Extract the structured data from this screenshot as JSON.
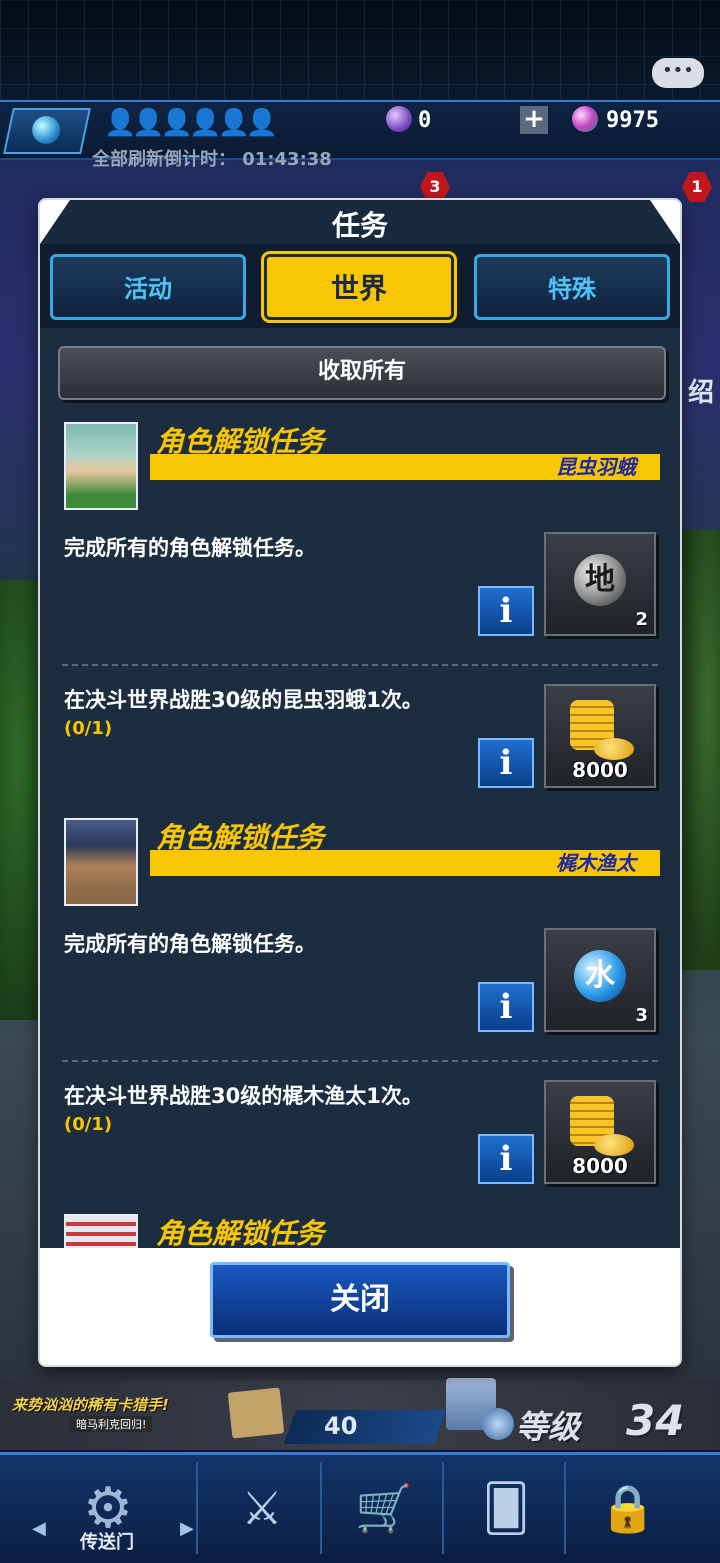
{
  "top": {
    "orb_count": "0",
    "gem_count": "9975",
    "refresh_label": "全部刷新倒计时：",
    "refresh_time": "01:43:38",
    "badge_left": "3",
    "badge_right": "1",
    "side_text": "绍"
  },
  "modal": {
    "title": "任务",
    "tabs": [
      {
        "label": "活动",
        "active": false
      },
      {
        "label": "世界",
        "active": true
      },
      {
        "label": "特殊",
        "active": false
      }
    ],
    "collect_all": "收取所有",
    "sections": [
      {
        "title": "角色解锁任务",
        "character": "昆虫羽蛾",
        "quests": [
          {
            "text": "完成所有的角色解锁任务。",
            "progress": "",
            "reward": {
              "type": "orb",
              "glyph": "地",
              "count": "2",
              "icon": "earth-orb-icon"
            }
          },
          {
            "text": "在决斗世界战胜30级的昆虫羽蛾1次。",
            "progress": "(0/1)",
            "reward": {
              "type": "coins",
              "count": "8000",
              "icon": "gold-coins-icon"
            }
          }
        ]
      },
      {
        "title": "角色解锁任务",
        "character": "梶木渔太",
        "quests": [
          {
            "text": "完成所有的角色解锁任务。",
            "progress": "",
            "reward": {
              "type": "orb",
              "glyph": "水",
              "count": "3",
              "icon": "water-orb-icon"
            }
          },
          {
            "text": "在决斗世界战胜30级的梶木渔太1次。",
            "progress": "(0/1)",
            "reward": {
              "type": "coins",
              "count": "8000",
              "icon": "gold-coins-icon"
            }
          }
        ]
      },
      {
        "title": "角色解锁任务",
        "character": "",
        "quests": []
      }
    ],
    "close": "关闭"
  },
  "bottom": {
    "promo": "来势汹汹的稀有卡猎手!",
    "promo_sub": "暗马利克回归!",
    "stage_number": "40",
    "level_label": "等级",
    "level_value": "34",
    "nav_label": "传送门"
  },
  "colors": {
    "accent_yellow": "#f9c604",
    "panel_bg": "#1c2d40",
    "tab_blue": "#3ba7e0",
    "character_name": "#1e2aa0"
  }
}
